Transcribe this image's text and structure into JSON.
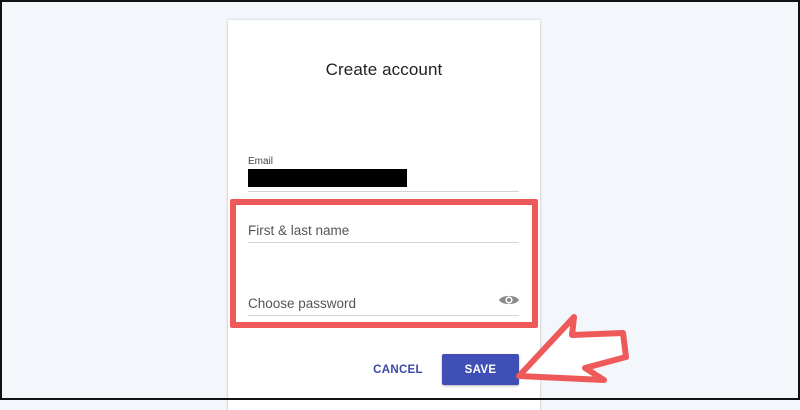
{
  "form": {
    "title": "Create account",
    "email_label": "Email",
    "name_placeholder": "First & last name",
    "password_placeholder": "Choose password",
    "cancel_label": "CANCEL",
    "save_label": "SAVE"
  },
  "icons": {
    "password_toggle": "eye-icon",
    "annotation_arrow": "arrow-icon"
  },
  "colors": {
    "page_background": "#f3f6fa",
    "primary": "#3f4fb5",
    "text_button": "#3a4aa8",
    "annotation": "#ee5a5a"
  }
}
